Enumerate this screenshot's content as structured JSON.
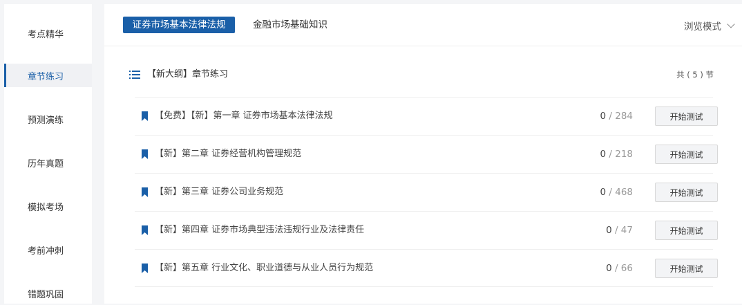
{
  "sidebar": {
    "items": [
      {
        "label": "考点精华",
        "active": false
      },
      {
        "label": "章节练习",
        "active": true
      },
      {
        "label": "预测演练",
        "active": false
      },
      {
        "label": "历年真题",
        "active": false
      },
      {
        "label": "模拟考场",
        "active": false
      },
      {
        "label": "考前冲刺",
        "active": false
      },
      {
        "label": "错题巩固",
        "active": false
      }
    ]
  },
  "tabs": {
    "active_label": "证券市场基本法律法规",
    "inactive_label": "金融市场基础知识"
  },
  "mode": {
    "label": "浏览模式"
  },
  "section": {
    "title": "【新大纲】章节练习",
    "count_text": "共 ( 5 ) 节"
  },
  "chapters": [
    {
      "title": "【免费】【新】第一章 证券市场基本法律法规",
      "done": "0",
      "total": "/ 284",
      "button": "开始测试"
    },
    {
      "title": "【新】第二章 证券经营机构管理规范",
      "done": "0",
      "total": "/ 218",
      "button": "开始测试"
    },
    {
      "title": "【新】第三章 证券公司业务规范",
      "done": "0",
      "total": "/ 468",
      "button": "开始测试"
    },
    {
      "title": "【新】第四章 证券市场典型违法违规行业及法律责任",
      "done": "0",
      "total": "/ 47",
      "button": "开始测试"
    },
    {
      "title": "【新】第五章 行业文化、职业道德与从业人员行为规范",
      "done": "0",
      "total": "/ 66",
      "button": "开始测试"
    }
  ],
  "colors": {
    "accent": "#1a5fa8",
    "background": "#f4f5f7",
    "panel": "#ffffff"
  }
}
